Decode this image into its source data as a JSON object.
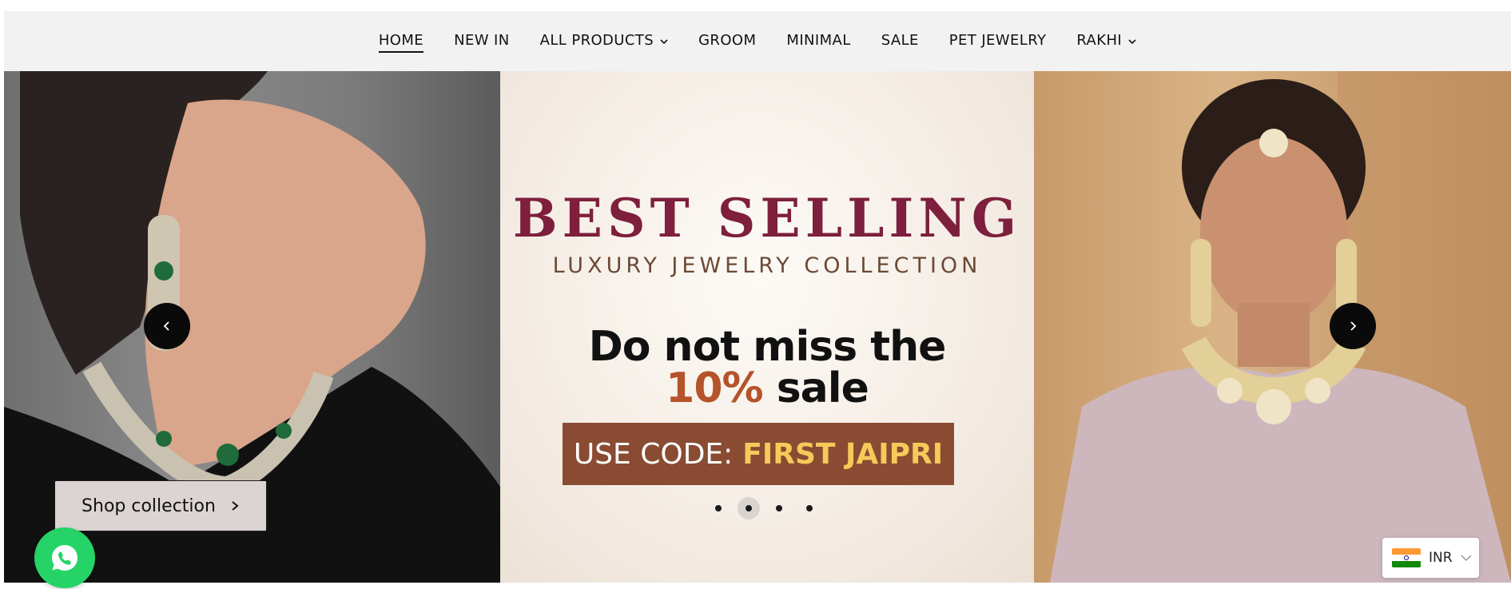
{
  "nav": {
    "items": [
      {
        "label": "HOME",
        "active": true,
        "dropdown": false
      },
      {
        "label": "NEW IN",
        "active": false,
        "dropdown": false
      },
      {
        "label": "ALL PRODUCTS",
        "active": false,
        "dropdown": true
      },
      {
        "label": "GROOM",
        "active": false,
        "dropdown": false
      },
      {
        "label": "MINIMAL",
        "active": false,
        "dropdown": false
      },
      {
        "label": "SALE",
        "active": false,
        "dropdown": false
      },
      {
        "label": "PET JEWELRY",
        "active": false,
        "dropdown": false
      },
      {
        "label": "RAKHI",
        "active": false,
        "dropdown": true
      }
    ]
  },
  "hero": {
    "title": "BEST SELLING",
    "subtitle": "LUXURY JEWELRY COLLECTION",
    "line1": "Do not miss the",
    "line2_pct": "10%",
    "line2_rest": " sale",
    "code_label": "USE CODE:",
    "code_value": "FIRST JAIPRI",
    "shop_button": "Shop collection",
    "slides_total": 4,
    "active_slide": 2,
    "colors": {
      "title": "#7d1f3d",
      "percent": "#b5532a",
      "code_bg": "#8a4b33",
      "code_value": "#f6c95a"
    }
  },
  "widgets": {
    "currency": "INR",
    "whatsapp_icon": "whatsapp-icon"
  }
}
